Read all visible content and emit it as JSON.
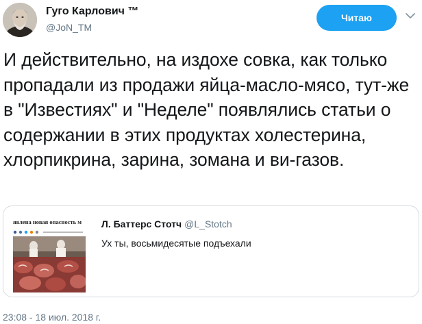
{
  "author": {
    "name": "Гуго Карлович ™",
    "handle": "@JoN_TM"
  },
  "follow_button": {
    "label": "Читаю"
  },
  "tweet": {
    "text": "И действительно, на издохе совка, как только пропадали из продажи яйца-масло-мясо, тут-же в \"Известиях\" и \"Неделе\" появлялись статьи о содержании в этих продуктах холестерина, хлорпикрина, зарина, зомана и ви-газов."
  },
  "quoted_tweet": {
    "name": "Л. Баттерс Стотч",
    "handle": "@L_Stotch",
    "text": "Ух ты, восьмидесятые подъехали",
    "thumbnail_headline": "явлена новая опасность м"
  },
  "timestamp": "23:08 - 18 июл. 2018 г.",
  "colors": {
    "accent": "#1da1f2",
    "text": "#14171a",
    "secondary": "#657786",
    "border": "#d4dbe1"
  },
  "icons": [
    "avatar-portrait",
    "chevron-down-icon"
  ]
}
